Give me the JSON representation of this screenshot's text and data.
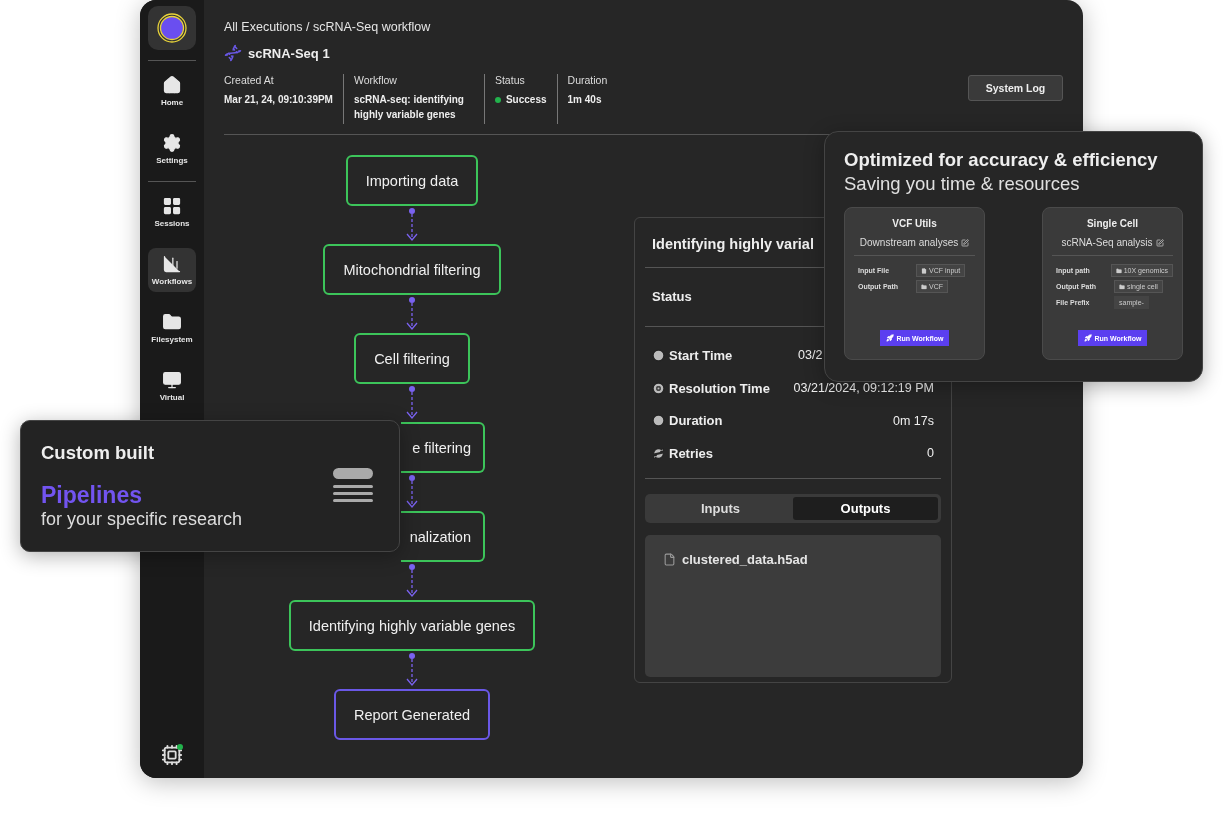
{
  "sidebar": {
    "items": [
      {
        "label": "Home",
        "selected": false
      },
      {
        "label": "Settings",
        "selected": false
      },
      {
        "label": "Sessions",
        "selected": false
      },
      {
        "label": "Workflows",
        "selected": true
      },
      {
        "label": "Filesystem",
        "selected": false
      },
      {
        "label": "Virtual",
        "selected": false
      }
    ]
  },
  "breadcrumb": "All Executions / scRNA-Seq workflow",
  "execution_title": "scRNA-Seq 1",
  "meta": [
    {
      "label": "Created At",
      "value": "Mar 21, 24, 09:10:39PM"
    },
    {
      "label": "Workflow",
      "value": "scRNA-seq: identifying highly variable genes"
    },
    {
      "label": "Status",
      "value": "Success",
      "kind": "status"
    },
    {
      "label": "Duration",
      "value": "1m 40s"
    }
  ],
  "system_log_button": "System Log",
  "pipeline": [
    {
      "label": "Importing data",
      "kind": "step",
      "covered": false
    },
    {
      "label": "Mitochondrial filtering",
      "kind": "step",
      "covered": false
    },
    {
      "label": "Cell filtering",
      "kind": "step",
      "covered": false
    },
    {
      "label": "e filtering",
      "kind": "step",
      "covered": true
    },
    {
      "label": "nalization",
      "kind": "step",
      "covered": true
    },
    {
      "label": "Identifying highly variable genes",
      "kind": "step",
      "covered": false
    },
    {
      "label": "Report Generated",
      "kind": "report",
      "covered": false
    }
  ],
  "detail_panel": {
    "title": "Identifying highly varial",
    "status_label": "Status",
    "rows": [
      {
        "label": "Start Time",
        "value": "03/2",
        "covered": true
      },
      {
        "label": "Resolution Time",
        "value": "03/21/2024, 09:12:19 PM"
      },
      {
        "label": "Duration",
        "value": "0m 17s"
      },
      {
        "label": "Retries",
        "value": "0"
      }
    ],
    "tabs": [
      {
        "label": "Inputs",
        "selected": false
      },
      {
        "label": "Outputs",
        "selected": true
      }
    ],
    "files": [
      "clustered_data.h5ad"
    ]
  },
  "promo_custom": {
    "heading": "Custom built",
    "highlight": "Pipelines",
    "subtitle": "for your specific research"
  },
  "promo_optimized": {
    "heading": "Optimized for accuracy & efficiency",
    "subtitle": "Saving you time & resources",
    "workflows": [
      {
        "category": "VCF Utils",
        "name": "Downstream analyses",
        "button": "Run Workflow",
        "params": [
          {
            "label": "Input File",
            "value": "VCF input",
            "kind": "file"
          },
          {
            "label": "Output Path",
            "value": "VCF",
            "kind": "folder"
          }
        ]
      },
      {
        "category": "Single Cell",
        "name": "scRNA-Seq analysis",
        "button": "Run Workflow",
        "params": [
          {
            "label": "Input path",
            "value": "10X genomics",
            "kind": "folder"
          },
          {
            "label": "Output Path",
            "value": "single cell",
            "kind": "folder"
          },
          {
            "label": "File Prefix",
            "value": "sample-",
            "kind": "text"
          }
        ]
      }
    ]
  }
}
